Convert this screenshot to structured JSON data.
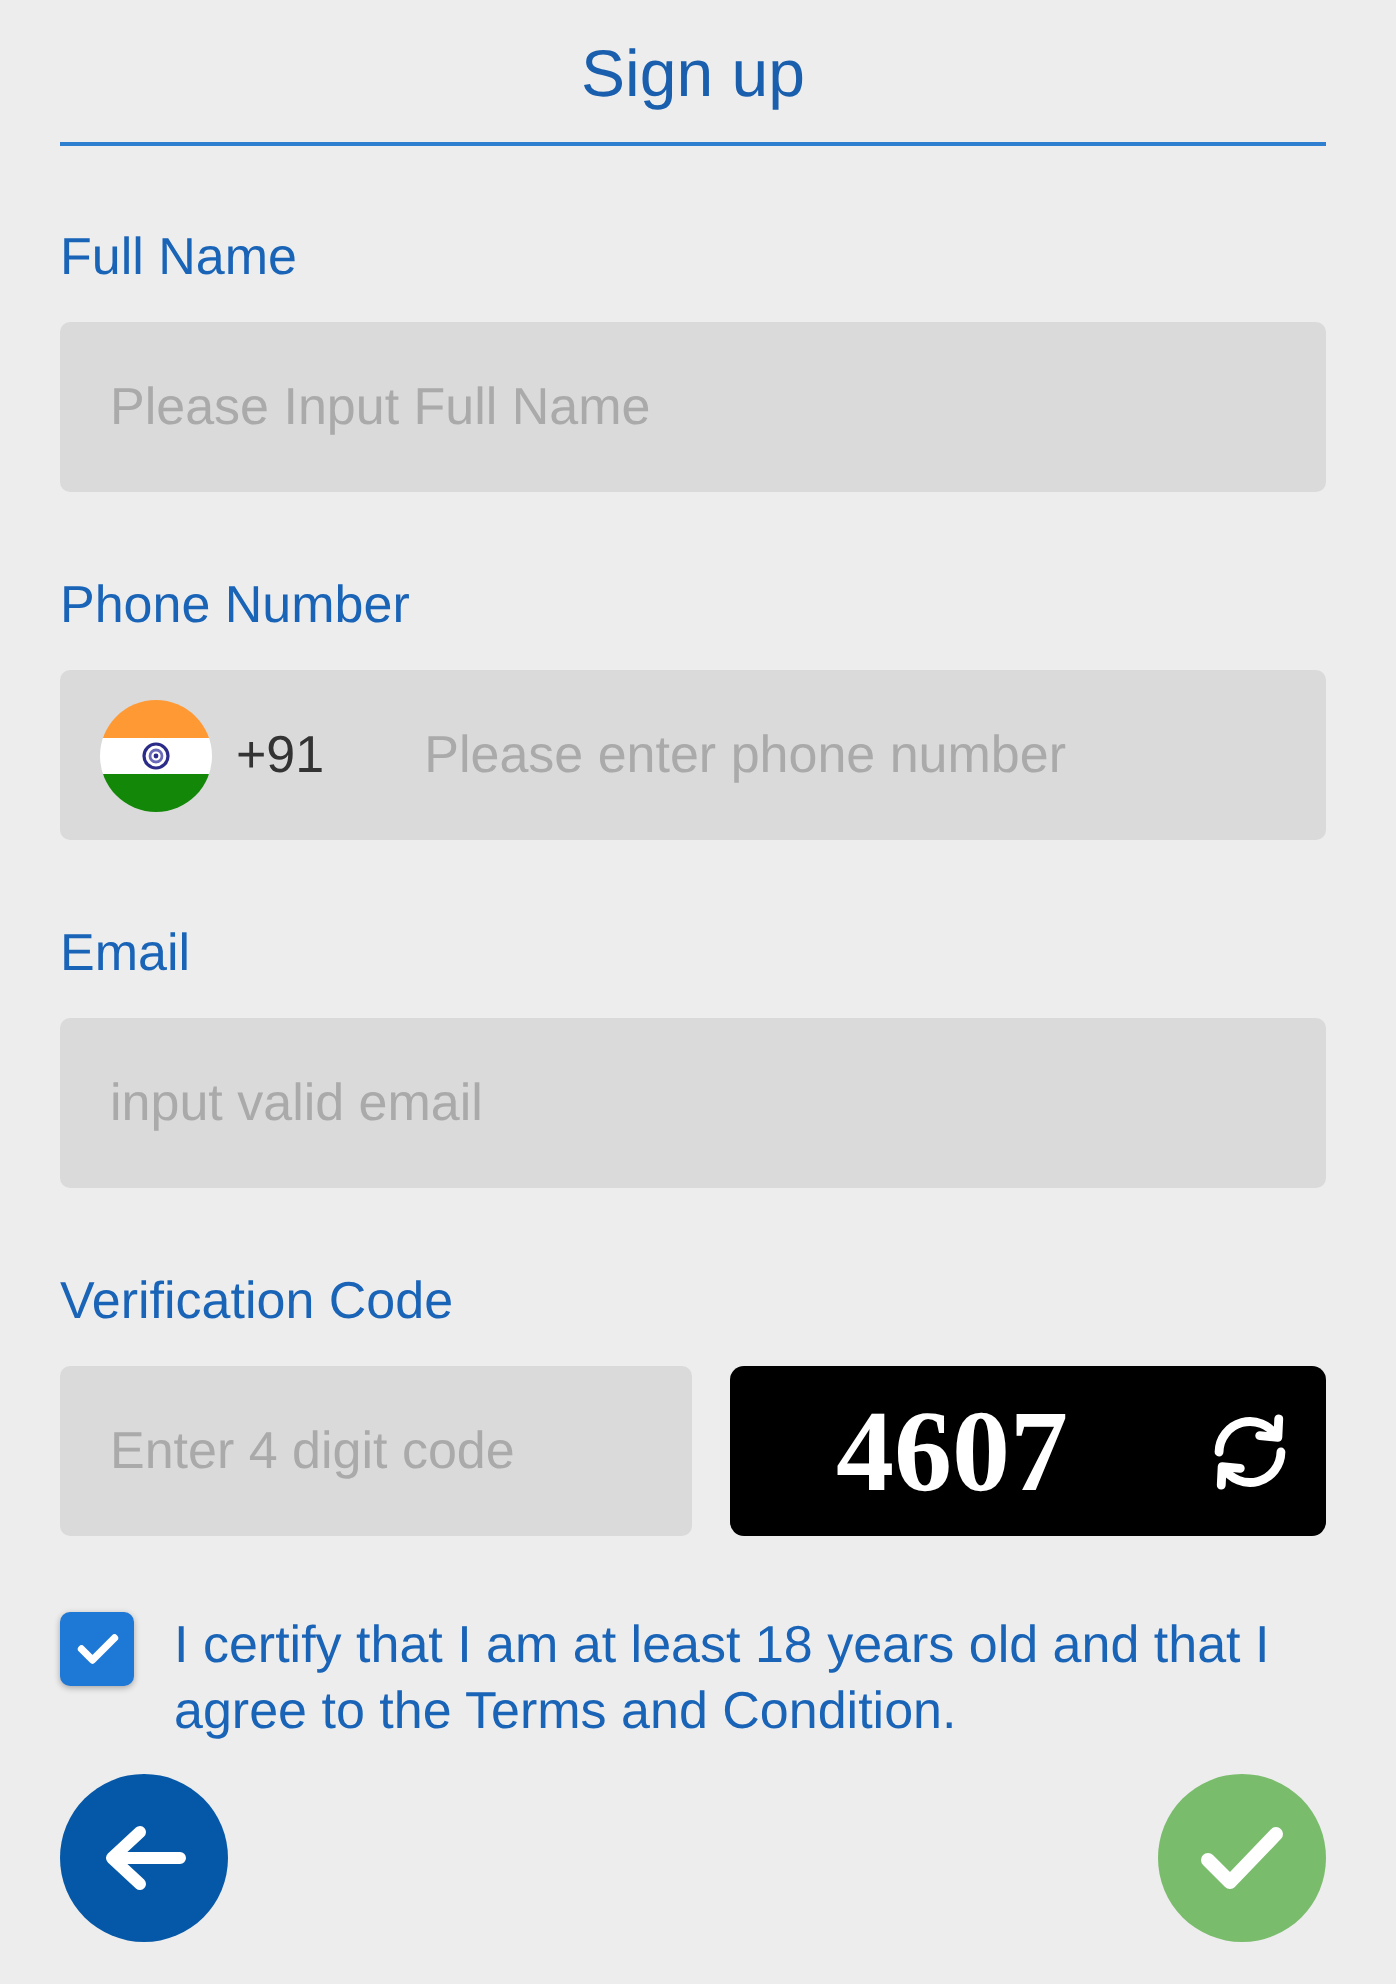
{
  "title": "Sign up",
  "fields": [
    {
      "kind": "text",
      "label": "Full Name",
      "placeholder": "Please Input Full Name"
    },
    {
      "kind": "phone",
      "label": "Phone Number",
      "country_code": "+91",
      "placeholder": "Please enter phone number"
    },
    {
      "kind": "text",
      "label": "Email",
      "placeholder": "input valid email"
    },
    {
      "kind": "captcha",
      "label": "Verification Code",
      "placeholder": "Enter 4 digit code",
      "captcha": "4607"
    }
  ],
  "agreement": {
    "checked": true,
    "text": "I certify that I am at least 18 years old and that I agree to the Terms and Condition."
  },
  "buttons": [
    {
      "kind": "back"
    },
    {
      "kind": "submit"
    }
  ]
}
